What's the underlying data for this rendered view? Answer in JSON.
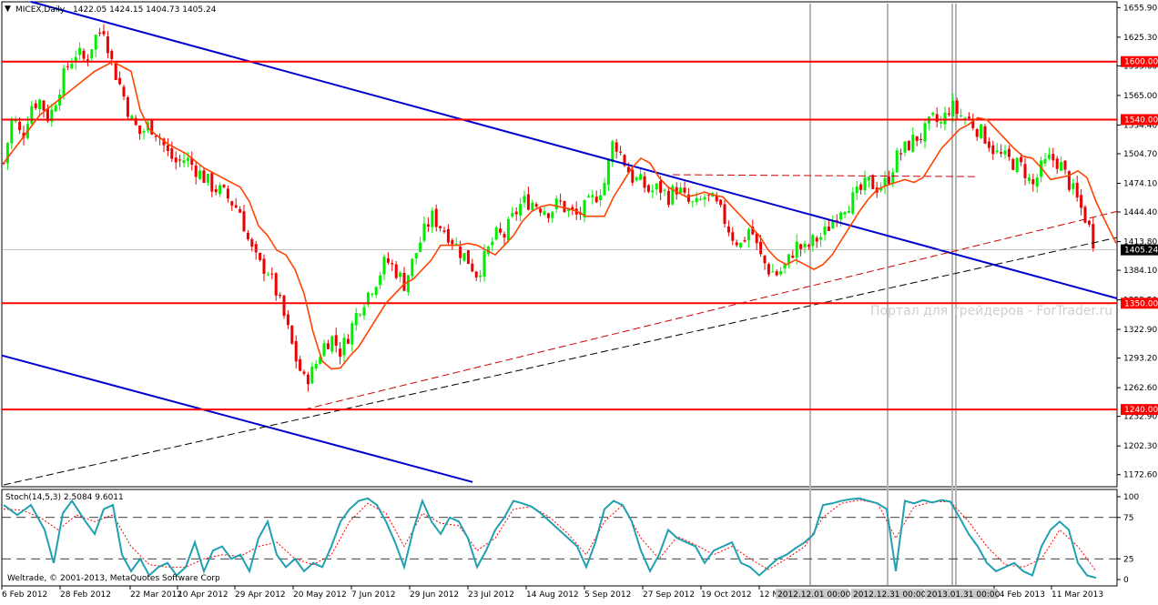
{
  "header": {
    "title": "MICEX,Daily",
    "ohlc": "1422.05 1424.15 1404.73 1405.24"
  },
  "colors": {
    "bull": "#00ee00",
    "bear": "#ee0000",
    "hline": "#ff0000",
    "trend": "#0000cc",
    "ma": "#ff4400",
    "stoch_main": "#20a0b0",
    "stoch_signal": "#ff0000",
    "price_tag": "#000000",
    "level_tag": "#ff0000"
  },
  "price_axis": {
    "ticks": [
      "1655.90",
      "1625.30",
      "1595.60",
      "1565.00",
      "1534.40",
      "1504.70",
      "1474.10",
      "1444.40",
      "1413.80",
      "1384.10",
      "1353.50",
      "1322.90",
      "1293.20",
      "1262.60",
      "1232.90",
      "1202.30",
      "1172.60"
    ],
    "current": "1405.24"
  },
  "levels": [
    {
      "value": 1600.0,
      "label": "1600.00"
    },
    {
      "value": 1540.0,
      "label": "1540.00"
    },
    {
      "value": 1350.0,
      "label": "1350.00"
    },
    {
      "value": 1240.0,
      "label": "1240.00"
    }
  ],
  "time_axis": {
    "labels": [
      "6 Feb 2012",
      "28 Feb 2012",
      "22 Mar 2012",
      "10 Apr 2012",
      "29 Apr 2012",
      "20 May 2012",
      "7 Jun 2012",
      "29 Jun 2012",
      "23 Jul 2012",
      "14 Aug 2012",
      "5 Sep 2012",
      "27 Sep 2012",
      "19 Oct 2012",
      "12 N",
      "14 Feb 2013",
      "11 Mar 2013"
    ],
    "markers": [
      "2012.12.01 00:00",
      "2012.12.31 00:00",
      "2013.01.31 00:00"
    ]
  },
  "stoch": {
    "title": "Stoch(14,5,3) 2.5084 9.6011",
    "ticks": [
      "100",
      "75",
      "25",
      "0"
    ]
  },
  "footer": {
    "copyright": "Weltrade, © 2001-2013, MetaQuotes Software Corp"
  },
  "watermark": "Портал для трейдеров - ForTrader.ru",
  "chart_data": {
    "type": "candlestick",
    "symbol": "MICEX",
    "timeframe": "Daily",
    "ylim": [
      1162,
      1660
    ],
    "close_path": [
      [
        0,
        1495
      ],
      [
        10,
        1545
      ],
      [
        20,
        1520
      ],
      [
        30,
        1555
      ],
      [
        40,
        1560
      ],
      [
        50,
        1540
      ],
      [
        60,
        1570
      ],
      [
        70,
        1595
      ],
      [
        80,
        1610
      ],
      [
        90,
        1600
      ],
      [
        100,
        1625
      ],
      [
        110,
        1635
      ],
      [
        120,
        1595
      ],
      [
        130,
        1570
      ],
      [
        140,
        1540
      ],
      [
        150,
        1525
      ],
      [
        160,
        1535
      ],
      [
        170,
        1525
      ],
      [
        180,
        1505
      ],
      [
        190,
        1495
      ],
      [
        200,
        1500
      ],
      [
        210,
        1490
      ],
      [
        220,
        1480
      ],
      [
        230,
        1470
      ],
      [
        240,
        1465
      ],
      [
        250,
        1455
      ],
      [
        260,
        1445
      ],
      [
        270,
        1410
      ],
      [
        280,
        1390
      ],
      [
        290,
        1385
      ],
      [
        300,
        1360
      ],
      [
        310,
        1330
      ],
      [
        320,
        1295
      ],
      [
        330,
        1270
      ],
      [
        340,
        1280
      ],
      [
        350,
        1305
      ],
      [
        360,
        1315
      ],
      [
        370,
        1300
      ],
      [
        380,
        1320
      ],
      [
        390,
        1345
      ],
      [
        400,
        1360
      ],
      [
        410,
        1375
      ],
      [
        420,
        1395
      ],
      [
        430,
        1385
      ],
      [
        440,
        1370
      ],
      [
        450,
        1395
      ],
      [
        460,
        1420
      ],
      [
        470,
        1440
      ],
      [
        480,
        1430
      ],
      [
        490,
        1420
      ],
      [
        500,
        1405
      ],
      [
        510,
        1395
      ],
      [
        520,
        1380
      ],
      [
        530,
        1400
      ],
      [
        540,
        1420
      ],
      [
        550,
        1420
      ],
      [
        560,
        1440
      ],
      [
        570,
        1455
      ],
      [
        580,
        1455
      ],
      [
        590,
        1450
      ],
      [
        600,
        1445
      ],
      [
        610,
        1455
      ],
      [
        620,
        1445
      ],
      [
        630,
        1440
      ],
      [
        640,
        1450
      ],
      [
        650,
        1460
      ],
      [
        660,
        1475
      ],
      [
        670,
        1520
      ],
      [
        680,
        1500
      ],
      [
        690,
        1480
      ],
      [
        700,
        1475
      ],
      [
        710,
        1465
      ],
      [
        720,
        1470
      ],
      [
        730,
        1460
      ],
      [
        740,
        1470
      ],
      [
        750,
        1455
      ],
      [
        760,
        1450
      ],
      [
        770,
        1460
      ],
      [
        780,
        1455
      ],
      [
        790,
        1440
      ],
      [
        800,
        1420
      ],
      [
        810,
        1410
      ],
      [
        820,
        1430
      ],
      [
        830,
        1400
      ],
      [
        840,
        1385
      ],
      [
        850,
        1380
      ],
      [
        860,
        1390
      ],
      [
        870,
        1410
      ],
      [
        880,
        1405
      ],
      [
        890,
        1415
      ],
      [
        900,
        1420
      ],
      [
        910,
        1435
      ],
      [
        920,
        1450
      ],
      [
        930,
        1455
      ],
      [
        940,
        1465
      ],
      [
        950,
        1475
      ],
      [
        960,
        1470
      ],
      [
        970,
        1475
      ],
      [
        980,
        1500
      ],
      [
        990,
        1510
      ],
      [
        1000,
        1520
      ],
      [
        1010,
        1525
      ],
      [
        1020,
        1540
      ],
      [
        1030,
        1535
      ],
      [
        1040,
        1555
      ],
      [
        1050,
        1545
      ],
      [
        1060,
        1540
      ],
      [
        1070,
        1530
      ],
      [
        1080,
        1520
      ],
      [
        1090,
        1505
      ],
      [
        1100,
        1500
      ],
      [
        1110,
        1495
      ],
      [
        1120,
        1490
      ],
      [
        1130,
        1470
      ],
      [
        1140,
        1490
      ],
      [
        1150,
        1500
      ],
      [
        1160,
        1495
      ],
      [
        1170,
        1475
      ],
      [
        1180,
        1455
      ],
      [
        1190,
        1435
      ],
      [
        1200,
        1405
      ]
    ],
    "ma_path": [
      [
        0,
        1495
      ],
      [
        20,
        1520
      ],
      [
        40,
        1545
      ],
      [
        60,
        1560
      ],
      [
        80,
        1575
      ],
      [
        100,
        1590
      ],
      [
        120,
        1600
      ],
      [
        140,
        1590
      ],
      [
        150,
        1550
      ],
      [
        160,
        1530
      ],
      [
        180,
        1515
      ],
      [
        200,
        1505
      ],
      [
        220,
        1490
      ],
      [
        240,
        1480
      ],
      [
        260,
        1470
      ],
      [
        270,
        1455
      ],
      [
        280,
        1430
      ],
      [
        290,
        1420
      ],
      [
        300,
        1405
      ],
      [
        310,
        1400
      ],
      [
        320,
        1385
      ],
      [
        330,
        1360
      ],
      [
        340,
        1320
      ],
      [
        350,
        1290
      ],
      [
        360,
        1282
      ],
      [
        370,
        1283
      ],
      [
        380,
        1295
      ],
      [
        390,
        1305
      ],
      [
        400,
        1320
      ],
      [
        410,
        1335
      ],
      [
        420,
        1350
      ],
      [
        430,
        1360
      ],
      [
        440,
        1370
      ],
      [
        450,
        1375
      ],
      [
        460,
        1385
      ],
      [
        470,
        1395
      ],
      [
        480,
        1410
      ],
      [
        490,
        1410
      ],
      [
        500,
        1410
      ],
      [
        510,
        1412
      ],
      [
        520,
        1410
      ],
      [
        530,
        1405
      ],
      [
        540,
        1400
      ],
      [
        550,
        1410
      ],
      [
        560,
        1420
      ],
      [
        570,
        1435
      ],
      [
        580,
        1445
      ],
      [
        590,
        1450
      ],
      [
        600,
        1452
      ],
      [
        610,
        1450
      ],
      [
        620,
        1448
      ],
      [
        630,
        1445
      ],
      [
        640,
        1440
      ],
      [
        650,
        1440
      ],
      [
        660,
        1440
      ],
      [
        670,
        1460
      ],
      [
        680,
        1475
      ],
      [
        690,
        1490
      ],
      [
        700,
        1500
      ],
      [
        710,
        1495
      ],
      [
        720,
        1480
      ],
      [
        730,
        1470
      ],
      [
        740,
        1465
      ],
      [
        750,
        1460
      ],
      [
        760,
        1462
      ],
      [
        770,
        1465
      ],
      [
        780,
        1462
      ],
      [
        790,
        1460
      ],
      [
        800,
        1450
      ],
      [
        810,
        1440
      ],
      [
        820,
        1430
      ],
      [
        830,
        1420
      ],
      [
        840,
        1405
      ],
      [
        850,
        1395
      ],
      [
        860,
        1390
      ],
      [
        870,
        1395
      ],
      [
        880,
        1390
      ],
      [
        890,
        1385
      ],
      [
        900,
        1390
      ],
      [
        910,
        1400
      ],
      [
        920,
        1415
      ],
      [
        930,
        1430
      ],
      [
        940,
        1445
      ],
      [
        950,
        1458
      ],
      [
        960,
        1468
      ],
      [
        970,
        1472
      ],
      [
        980,
        1475
      ],
      [
        990,
        1478
      ],
      [
        1000,
        1475
      ],
      [
        1010,
        1480
      ],
      [
        1020,
        1495
      ],
      [
        1030,
        1510
      ],
      [
        1040,
        1520
      ],
      [
        1050,
        1530
      ],
      [
        1060,
        1535
      ],
      [
        1070,
        1542
      ],
      [
        1080,
        1540
      ],
      [
        1090,
        1530
      ],
      [
        1100,
        1520
      ],
      [
        1110,
        1510
      ],
      [
        1120,
        1502
      ],
      [
        1130,
        1500
      ],
      [
        1140,
        1490
      ],
      [
        1150,
        1478
      ],
      [
        1160,
        1480
      ],
      [
        1170,
        1482
      ],
      [
        1180,
        1487
      ],
      [
        1190,
        1480
      ],
      [
        1200,
        1455
      ],
      [
        1210,
        1435
      ],
      [
        1222,
        1412
      ]
    ],
    "stoch_main_path": [
      [
        0,
        90
      ],
      [
        15,
        78
      ],
      [
        30,
        90
      ],
      [
        45,
        60
      ],
      [
        55,
        20
      ],
      [
        65,
        80
      ],
      [
        75,
        95
      ],
      [
        90,
        70
      ],
      [
        100,
        55
      ],
      [
        110,
        85
      ],
      [
        120,
        90
      ],
      [
        130,
        30
      ],
      [
        140,
        10
      ],
      [
        150,
        25
      ],
      [
        160,
        5
      ],
      [
        170,
        15
      ],
      [
        180,
        20
      ],
      [
        190,
        5
      ],
      [
        200,
        15
      ],
      [
        210,
        45
      ],
      [
        220,
        10
      ],
      [
        230,
        35
      ],
      [
        240,
        40
      ],
      [
        250,
        25
      ],
      [
        260,
        30
      ],
      [
        270,
        10
      ],
      [
        280,
        50
      ],
      [
        290,
        70
      ],
      [
        300,
        30
      ],
      [
        310,
        15
      ],
      [
        320,
        25
      ],
      [
        330,
        10
      ],
      [
        340,
        20
      ],
      [
        350,
        15
      ],
      [
        360,
        40
      ],
      [
        370,
        70
      ],
      [
        380,
        85
      ],
      [
        390,
        95
      ],
      [
        400,
        98
      ],
      [
        410,
        90
      ],
      [
        420,
        70
      ],
      [
        430,
        45
      ],
      [
        440,
        15
      ],
      [
        450,
        60
      ],
      [
        460,
        95
      ],
      [
        470,
        70
      ],
      [
        480,
        55
      ],
      [
        490,
        75
      ],
      [
        500,
        70
      ],
      [
        510,
        50
      ],
      [
        520,
        15
      ],
      [
        530,
        35
      ],
      [
        540,
        60
      ],
      [
        550,
        75
      ],
      [
        560,
        95
      ],
      [
        570,
        92
      ],
      [
        580,
        88
      ],
      [
        590,
        80
      ],
      [
        600,
        70
      ],
      [
        610,
        60
      ],
      [
        620,
        50
      ],
      [
        630,
        40
      ],
      [
        640,
        15
      ],
      [
        650,
        45
      ],
      [
        660,
        85
      ],
      [
        670,
        95
      ],
      [
        680,
        90
      ],
      [
        690,
        70
      ],
      [
        700,
        35
      ],
      [
        710,
        10
      ],
      [
        720,
        30
      ],
      [
        730,
        60
      ],
      [
        740,
        50
      ],
      [
        750,
        45
      ],
      [
        760,
        40
      ],
      [
        770,
        20
      ],
      [
        780,
        35
      ],
      [
        790,
        40
      ],
      [
        800,
        45
      ],
      [
        810,
        20
      ],
      [
        820,
        15
      ],
      [
        830,
        5
      ],
      [
        840,
        15
      ],
      [
        850,
        25
      ],
      [
        860,
        30
      ],
      [
        870,
        38
      ],
      [
        880,
        45
      ],
      [
        890,
        55
      ],
      [
        900,
        90
      ],
      [
        910,
        92
      ],
      [
        920,
        95
      ],
      [
        930,
        97
      ],
      [
        940,
        98
      ],
      [
        950,
        95
      ],
      [
        960,
        92
      ],
      [
        970,
        85
      ],
      [
        980,
        10
      ],
      [
        990,
        95
      ],
      [
        1000,
        92
      ],
      [
        1010,
        96
      ],
      [
        1020,
        93
      ],
      [
        1030,
        96
      ],
      [
        1040,
        94
      ],
      [
        1050,
        75
      ],
      [
        1060,
        55
      ],
      [
        1070,
        40
      ],
      [
        1080,
        20
      ],
      [
        1090,
        10
      ],
      [
        1100,
        15
      ],
      [
        1110,
        20
      ],
      [
        1120,
        10
      ],
      [
        1130,
        5
      ],
      [
        1140,
        40
      ],
      [
        1150,
        60
      ],
      [
        1160,
        70
      ],
      [
        1170,
        60
      ],
      [
        1180,
        20
      ],
      [
        1190,
        5
      ],
      [
        1200,
        2
      ]
    ],
    "stoch_signal_path": [
      [
        0,
        85
      ],
      [
        20,
        84
      ],
      [
        40,
        75
      ],
      [
        60,
        60
      ],
      [
        80,
        78
      ],
      [
        100,
        70
      ],
      [
        120,
        78
      ],
      [
        140,
        40
      ],
      [
        160,
        18
      ],
      [
        180,
        15
      ],
      [
        200,
        15
      ],
      [
        220,
        25
      ],
      [
        240,
        30
      ],
      [
        260,
        28
      ],
      [
        280,
        40
      ],
      [
        300,
        45
      ],
      [
        320,
        25
      ],
      [
        340,
        18
      ],
      [
        360,
        30
      ],
      [
        380,
        70
      ],
      [
        400,
        92
      ],
      [
        420,
        80
      ],
      [
        440,
        40
      ],
      [
        460,
        80
      ],
      [
        480,
        68
      ],
      [
        500,
        65
      ],
      [
        520,
        35
      ],
      [
        540,
        50
      ],
      [
        560,
        85
      ],
      [
        580,
        88
      ],
      [
        600,
        75
      ],
      [
        620,
        55
      ],
      [
        640,
        30
      ],
      [
        660,
        70
      ],
      [
        680,
        90
      ],
      [
        700,
        50
      ],
      [
        720,
        25
      ],
      [
        740,
        52
      ],
      [
        760,
        42
      ],
      [
        780,
        30
      ],
      [
        800,
        40
      ],
      [
        820,
        25
      ],
      [
        840,
        12
      ],
      [
        860,
        25
      ],
      [
        880,
        40
      ],
      [
        900,
        75
      ],
      [
        920,
        92
      ],
      [
        940,
        96
      ],
      [
        960,
        92
      ],
      [
        980,
        50
      ],
      [
        1000,
        88
      ],
      [
        1020,
        94
      ],
      [
        1040,
        94
      ],
      [
        1060,
        70
      ],
      [
        1080,
        40
      ],
      [
        1100,
        18
      ],
      [
        1120,
        15
      ],
      [
        1140,
        25
      ],
      [
        1160,
        60
      ],
      [
        1180,
        40
      ],
      [
        1200,
        10
      ]
    ]
  }
}
